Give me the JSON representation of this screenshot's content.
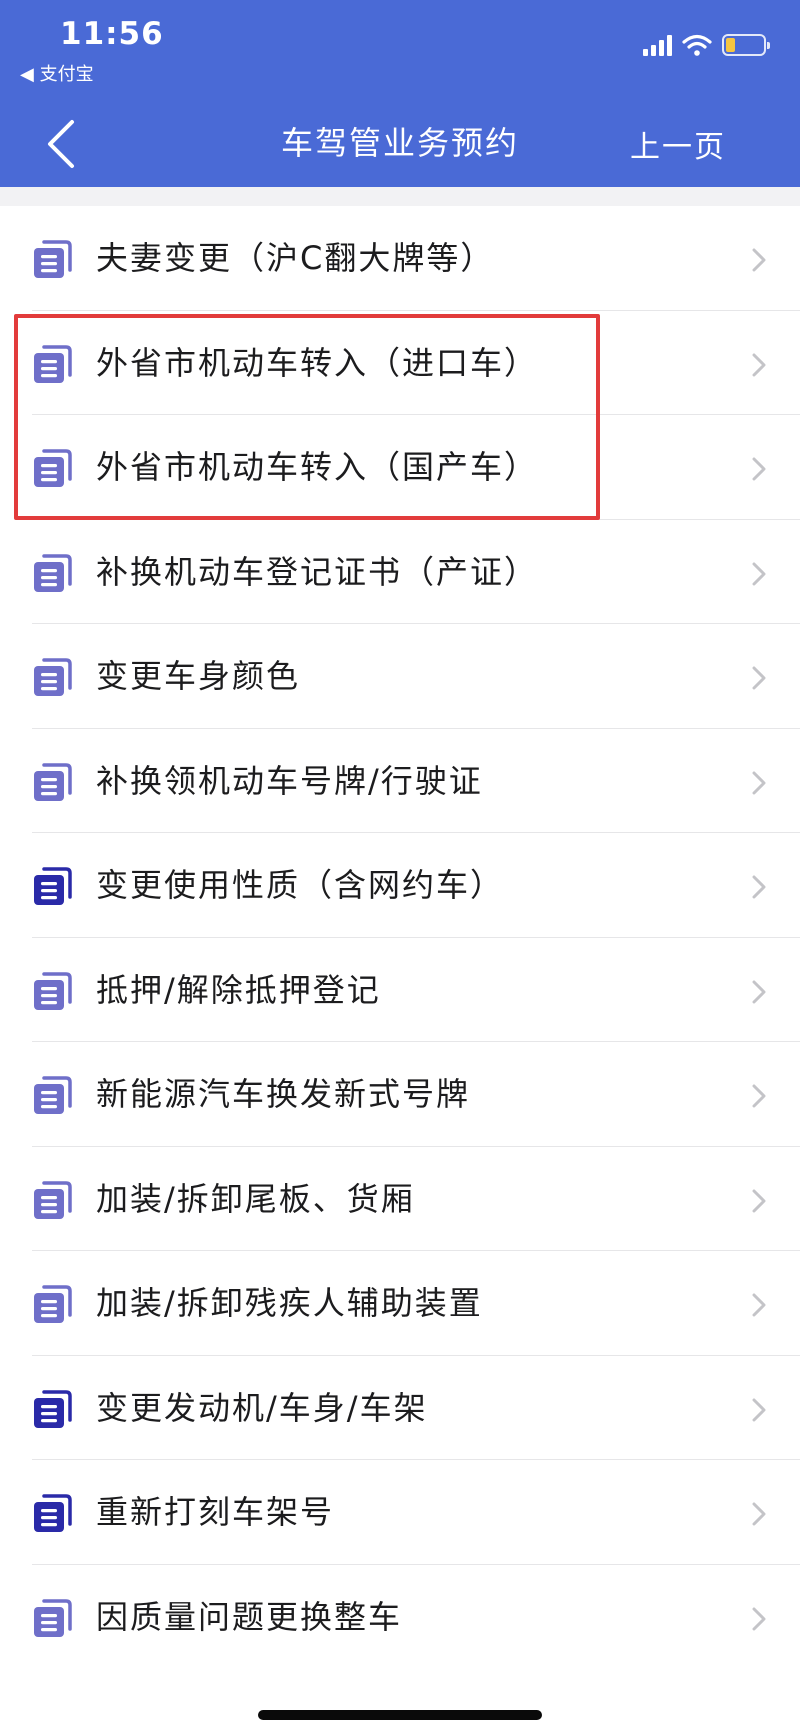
{
  "status_bar": {
    "time": "11:56",
    "back_app": "◀ 支付宝"
  },
  "nav": {
    "title": "车驾管业务预约",
    "prev_label": "上一页"
  },
  "colors": {
    "header_bg": "#4a6ad6",
    "icon_light": "#6f6fc9",
    "icon_dark": "#2a2aa8",
    "highlight": "#e23b3b"
  },
  "items": [
    {
      "label": "夫妻变更（沪C翻大牌等）",
      "icon": "document-icon",
      "icon_tone": "light"
    },
    {
      "label": "外省市机动车转入（进口车）",
      "icon": "document-icon",
      "icon_tone": "light"
    },
    {
      "label": "外省市机动车转入（国产车）",
      "icon": "document-icon",
      "icon_tone": "light"
    },
    {
      "label": "补换机动车登记证书（产证）",
      "icon": "document-icon",
      "icon_tone": "light"
    },
    {
      "label": "变更车身颜色",
      "icon": "document-icon",
      "icon_tone": "light"
    },
    {
      "label": "补换领机动车号牌/行驶证",
      "icon": "document-icon",
      "icon_tone": "light"
    },
    {
      "label": "变更使用性质（含网约车）",
      "icon": "document-icon",
      "icon_tone": "dark"
    },
    {
      "label": "抵押/解除抵押登记",
      "icon": "document-icon",
      "icon_tone": "light"
    },
    {
      "label": "新能源汽车换发新式号牌",
      "icon": "document-icon",
      "icon_tone": "light"
    },
    {
      "label": "加装/拆卸尾板、货厢",
      "icon": "document-icon",
      "icon_tone": "light"
    },
    {
      "label": "加装/拆卸残疾人辅助装置",
      "icon": "document-icon",
      "icon_tone": "light"
    },
    {
      "label": "变更发动机/车身/车架",
      "icon": "document-icon",
      "icon_tone": "dark"
    },
    {
      "label": "重新打刻车架号",
      "icon": "document-icon",
      "icon_tone": "dark"
    },
    {
      "label": "因质量问题更换整车",
      "icon": "document-icon",
      "icon_tone": "light"
    }
  ]
}
